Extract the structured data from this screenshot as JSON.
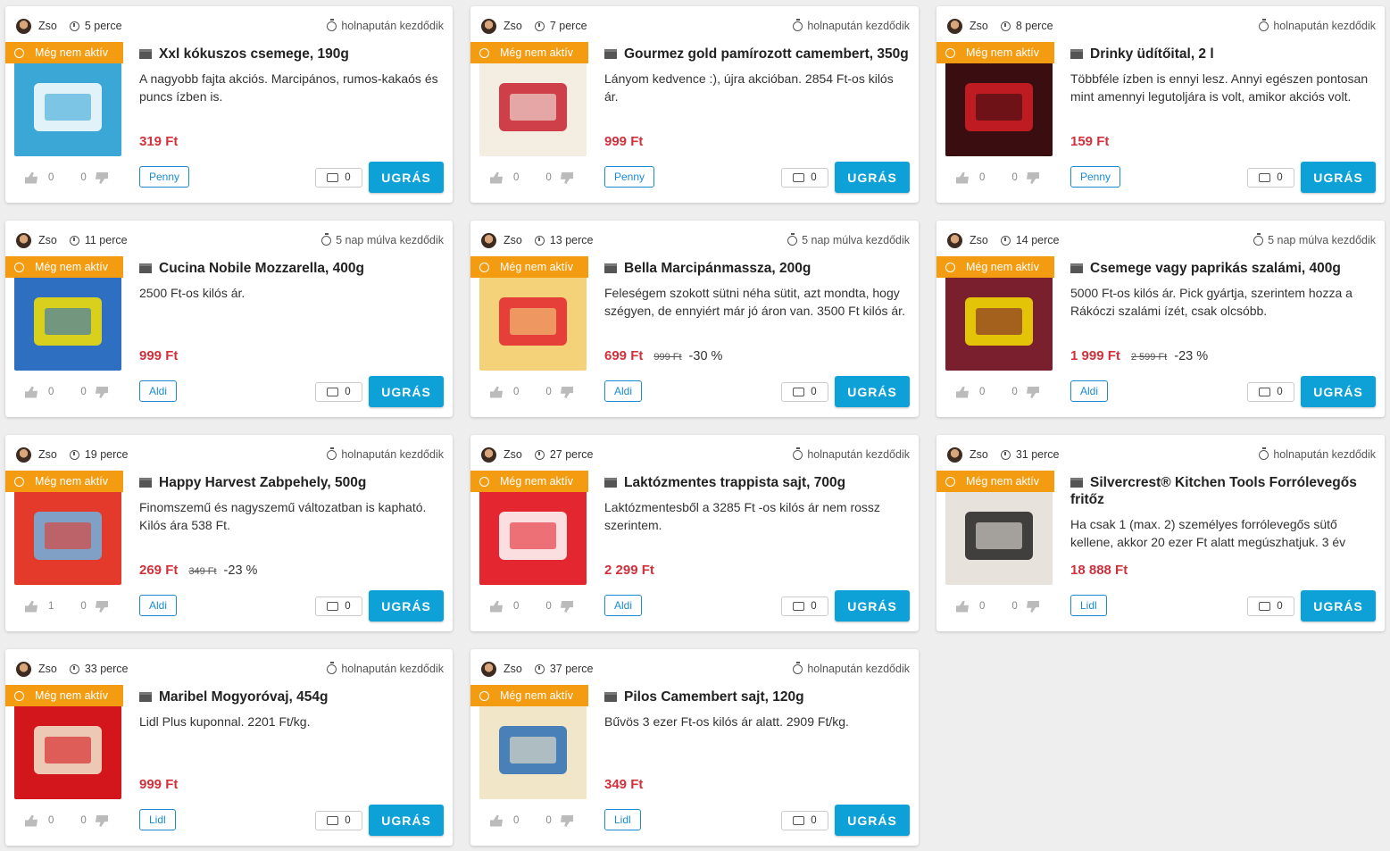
{
  "cards": [
    {
      "user": "Zso",
      "age": "5 perce",
      "starts": "holnapután kezdődik",
      "badge": "Még nem aktív",
      "title": "Xxl kókuszos csemege, 190g",
      "description": "A nagyobb fajta akciós. Marcipános, rumos-kakaós és puncs ízben is.",
      "price": "319 Ft",
      "old_price": "",
      "discount": "",
      "likes": "0",
      "dislikes": "0",
      "store": "Penny",
      "comments": "0",
      "button": "UGRÁS",
      "img_color": "#3aa7d6",
      "img_accent": "#ffffff"
    },
    {
      "user": "Zso",
      "age": "7 perce",
      "starts": "holnapután kezdődik",
      "badge": "Még nem aktív",
      "title": "Gourmez gold pamírozott camembert, 350g",
      "description": "Lányom kedvence :), újra akcióban. 2854 Ft-os kilós ár.",
      "price": "999 Ft",
      "old_price": "",
      "discount": "",
      "likes": "0",
      "dislikes": "0",
      "store": "Penny",
      "comments": "0",
      "button": "UGRÁS",
      "img_color": "#f4ede2",
      "img_accent": "#c8202e"
    },
    {
      "user": "Zso",
      "age": "8 perce",
      "starts": "holnapután kezdődik",
      "badge": "Még nem aktív",
      "title": "Drinky üdítőital, 2 l",
      "description": "Többféle ízben is ennyi lesz. Annyi egészen pontosan mint amennyi legutoljára is volt, amikor akciós volt.",
      "price": "159 Ft",
      "old_price": "",
      "discount": "",
      "likes": "0",
      "dislikes": "0",
      "store": "Penny",
      "comments": "0",
      "button": "UGRÁS",
      "img_color": "#3a0d10",
      "img_accent": "#d61f26"
    },
    {
      "user": "Zso",
      "age": "11 perce",
      "starts": "5 nap múlva kezdődik",
      "badge": "Még nem aktív",
      "title": "Cucina Nobile Mozzarella, 400g",
      "description": "2500 Ft-os kilós ár.",
      "price": "999 Ft",
      "old_price": "",
      "discount": "",
      "likes": "0",
      "dislikes": "0",
      "store": "Aldi",
      "comments": "0",
      "button": "UGRÁS",
      "img_color": "#2f6fc1",
      "img_accent": "#f7e200"
    },
    {
      "user": "Zso",
      "age": "13 perce",
      "starts": "5 nap múlva kezdődik",
      "badge": "Még nem aktív",
      "title": "Bella Marcipánmassza, 200g",
      "description": "Feleségem szokott sütni néha sütit, azt mondta, hogy szégyen, de ennyiért már jó áron van. 3500 Ft kilós ár.",
      "price": "699 Ft",
      "old_price": "999 Ft",
      "discount": "-30 %",
      "likes": "0",
      "dislikes": "0",
      "store": "Aldi",
      "comments": "0",
      "button": "UGRÁS",
      "img_color": "#f3d27a",
      "img_accent": "#e3262f"
    },
    {
      "user": "Zso",
      "age": "14 perce",
      "starts": "5 nap múlva kezdődik",
      "badge": "Még nem aktív",
      "title": "Csemege vagy paprikás szalámi, 400g",
      "description": "5000 Ft-os kilós ár. Pick gyártja, szerintem hozza a Rákóczi szalámi ízét, csak olcsóbb.",
      "price": "1 999 Ft",
      "old_price": "2 599 Ft",
      "discount": "-23 %",
      "likes": "0",
      "dislikes": "0",
      "store": "Aldi",
      "comments": "0",
      "button": "UGRÁS",
      "img_color": "#7a1f2e",
      "img_accent": "#f7e200"
    },
    {
      "user": "Zso",
      "age": "19 perce",
      "starts": "holnapután kezdődik",
      "badge": "Még nem aktív",
      "title": "Happy Harvest Zabpehely, 500g",
      "description": "Finomszemű és nagyszemű változatban is kapható. Kilós ára 538 Ft.",
      "price": "269 Ft",
      "old_price": "349 Ft",
      "discount": "-23 %",
      "likes": "1",
      "dislikes": "0",
      "store": "Aldi",
      "comments": "0",
      "button": "UGRÁS",
      "img_color": "#e33a2c",
      "img_accent": "#6fb3e0"
    },
    {
      "user": "Zso",
      "age": "27 perce",
      "starts": "holnapután kezdődik",
      "badge": "Még nem aktív",
      "title": "Laktózmentes trappista sajt, 700g",
      "description": "Laktózmentesből a 3285 Ft -os kilós ár nem rossz szerintem.",
      "price": "2 299 Ft",
      "old_price": "",
      "discount": "",
      "likes": "0",
      "dislikes": "0",
      "store": "Aldi",
      "comments": "0",
      "button": "UGRÁS",
      "img_color": "#e3262f",
      "img_accent": "#ffffff"
    },
    {
      "user": "Zso",
      "age": "31 perce",
      "starts": "holnapután kezdődik",
      "badge": "Még nem aktív",
      "title": "Silvercrest® Kitchen Tools Forrólevegős fritőz",
      "description": "Ha csak 1 (max. 2) személyes forrólevegős sütő kellene, akkor 20 ezer Ft alatt megúszhatjuk. 3 év",
      "price": "18 888 Ft",
      "old_price": "",
      "discount": "",
      "likes": "0",
      "dislikes": "0",
      "store": "Lidl",
      "comments": "0",
      "button": "UGRÁS",
      "img_color": "#e7e3dc",
      "img_accent": "#222222"
    },
    {
      "user": "Zso",
      "age": "33 perce",
      "starts": "holnapután kezdődik",
      "badge": "Még nem aktív",
      "title": "Maribel Mogyoróvaj, 454g",
      "description": "Lidl Plus kuponnal. 2201 Ft/kg.",
      "price": "999 Ft",
      "old_price": "",
      "discount": "",
      "likes": "0",
      "dislikes": "0",
      "store": "Lidl",
      "comments": "0",
      "button": "UGRÁS",
      "img_color": "#d3161c",
      "img_accent": "#f1e7cf"
    },
    {
      "user": "Zso",
      "age": "37 perce",
      "starts": "holnapután kezdődik",
      "badge": "Még nem aktív",
      "title": "Pilos Camembert sajt, 120g",
      "description": "Bűvös 3 ezer Ft-os kilós ár alatt. 2909 Ft/kg.",
      "price": "349 Ft",
      "old_price": "",
      "discount": "",
      "likes": "0",
      "dislikes": "0",
      "store": "Lidl",
      "comments": "0",
      "button": "UGRÁS",
      "img_color": "#f2e6c8",
      "img_accent": "#2c6db5"
    }
  ],
  "colors": {
    "accent": "#0ea1d8",
    "badge": "#f39c12",
    "price": "#d0313c",
    "store": "#1a8bd1"
  },
  "icons": {
    "clock": "clock-icon",
    "timer": "timer-icon",
    "store": "store-icon",
    "like": "thumb-up-icon",
    "dislike": "thumb-down-icon",
    "comment": "comment-icon"
  }
}
